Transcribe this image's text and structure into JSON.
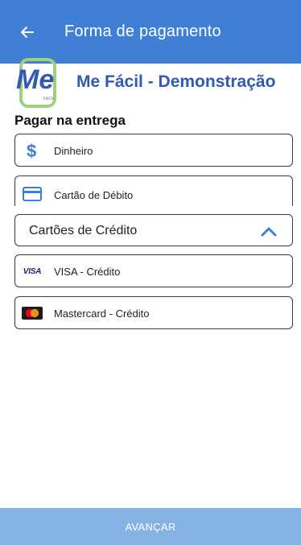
{
  "appbar": {
    "title": "Forma de pagamento",
    "back_icon": "arrow-left-icon"
  },
  "brand": {
    "logo_text": "Me",
    "logo_small": "FÁCIL",
    "title": "Me Fácil - Demonstração"
  },
  "section": {
    "title": "Pagar na entrega"
  },
  "options": {
    "cash": {
      "label": "Dinheiro",
      "icon": "dollar-icon"
    },
    "debit": {
      "label": "Cartão de Débito",
      "icon": "credit-card-icon"
    }
  },
  "credit_group": {
    "label": "Cartões de Crédito",
    "icon": "chevron-up-icon",
    "expanded": true,
    "items": [
      {
        "label": "VISA - Crédito",
        "icon": "visa-icon",
        "brand_text": "VISA"
      },
      {
        "label": "Mastercard - Crédito",
        "icon": "mastercard-icon"
      }
    ]
  },
  "footer": {
    "cta_label": "AVANÇAR"
  },
  "colors": {
    "primary": "#3f7fd4",
    "brand_title": "#2f59b3",
    "cta_disabled": "#86b1e3",
    "logo_green": "#9fd07f",
    "logo_blue": "#2f59b3"
  }
}
